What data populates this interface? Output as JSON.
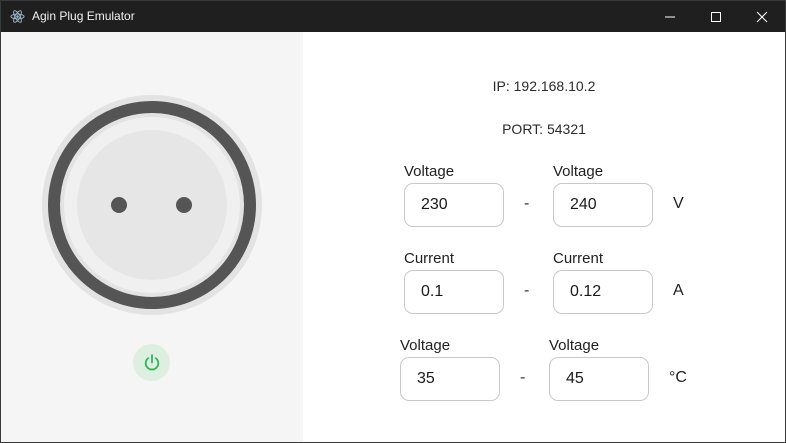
{
  "window": {
    "title": "Agin Plug Emulator"
  },
  "status": {
    "ip": "IP: 192.168.10.2",
    "port": "PORT: 54321"
  },
  "rows": [
    {
      "min_label": "Voltage",
      "min_value": "230",
      "max_label": "Voltage",
      "max_value": "240",
      "separator": "-",
      "unit": "V"
    },
    {
      "min_label": "Current",
      "min_value": "0.1",
      "max_label": "Current",
      "max_value": "0.12",
      "separator": "-",
      "unit": "A"
    },
    {
      "min_label": "Voltage",
      "min_value": "35",
      "max_label": "Voltage",
      "max_value": "45",
      "separator": "-",
      "unit": "°C"
    }
  ],
  "colors": {
    "titlebar": "#1f1f1f",
    "power_accent": "#2fb457",
    "socket_ring": "#555555"
  },
  "icons": {
    "app": "electron-atom-icon",
    "power": "power-icon"
  }
}
